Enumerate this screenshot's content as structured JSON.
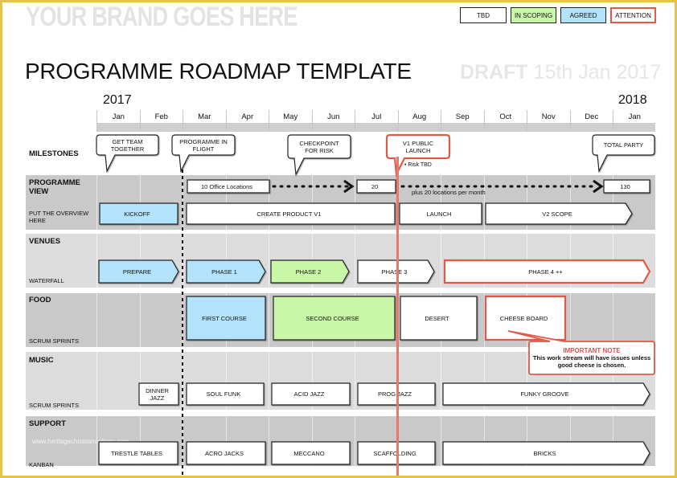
{
  "header": {
    "brand": "YOUR BRAND GOES HERE",
    "title": "PROGRAMME ROADMAP TEMPLATE",
    "draft_label": "DRAFT",
    "draft_date": "15th Jan 2017",
    "year_start": "2017",
    "year_end": "2018"
  },
  "legend": [
    {
      "label": "TBD",
      "color": "#ffffff"
    },
    {
      "label": "IN SCOPING",
      "color": "#c8f7a8"
    },
    {
      "label": "AGREED",
      "color": "#b3e3fb"
    },
    {
      "label": "ATTENTION",
      "color": "#ffffff",
      "border": "#e05a47"
    }
  ],
  "months": [
    "Jan",
    "Feb",
    "Mar",
    "Apr",
    "May",
    "Jun",
    "Jul",
    "Aug",
    "Sep",
    "Oct",
    "Nov",
    "Dec",
    "Jan"
  ],
  "colors": {
    "scoping": "#c8f7a8",
    "agreed": "#b3e3fb",
    "attention": "#e05a47",
    "band_dark": "#c9c9c9",
    "band_light": "#dcdcdc",
    "frame": "#e6c443"
  },
  "rows": {
    "milestones": {
      "label": "MILESTONES"
    },
    "programme": {
      "label": "PROGRAMME VIEW",
      "sub": "PUT THE OVERVIEW HERE"
    },
    "venues": {
      "label": "VENUES",
      "sub": "WATERFALL"
    },
    "food": {
      "label": "FOOD",
      "sub": "SCRUM SPRINTS"
    },
    "music": {
      "label": "MUSIC",
      "sub": "SCRUM SPRINTS"
    },
    "support": {
      "label": "SUPPORT",
      "sub": "KANBAN"
    }
  },
  "milestones": [
    "GET TEAM TOGETHER",
    "PROGRAMME IN FLIGHT",
    "CHECKPOINT FOR RISK",
    "V1 PUBLIC LAUNCH",
    "TOTAL PARTY"
  ],
  "milestone_note": "• Risk TBD",
  "programme_counts": [
    "10 Office Locations",
    "20",
    "130"
  ],
  "programme_note": "plus 20 locations per month",
  "programme_items": [
    "KICKOFF",
    "CREATE PRODUCT V1",
    "LAUNCH",
    "V2 SCOPE"
  ],
  "venues_items": [
    "PREPARE",
    "PHASE 1",
    "PHASE 2",
    "PHASE 3",
    "PHASE 4 ++"
  ],
  "food_items": [
    "FIRST COURSE",
    "SECOND COURSE",
    "DESERT",
    "CHEESE BOARD"
  ],
  "music_items": [
    "DINNER JAZZ",
    "SOUL FUNK",
    "ACID JAZZ",
    "PROG JAZZ",
    "FUNKY GROOVE"
  ],
  "support_items": [
    "TRESTLE TABLES",
    "ACRO JACKS",
    "MECCANO",
    "SCAFFOLDING",
    "BRICKS"
  ],
  "important_note": {
    "title": "IMPORTANT NOTE",
    "body": "This work stream will have issues unless good cheese is chosen."
  },
  "watermark": "www.heritagechristiancollege.com"
}
